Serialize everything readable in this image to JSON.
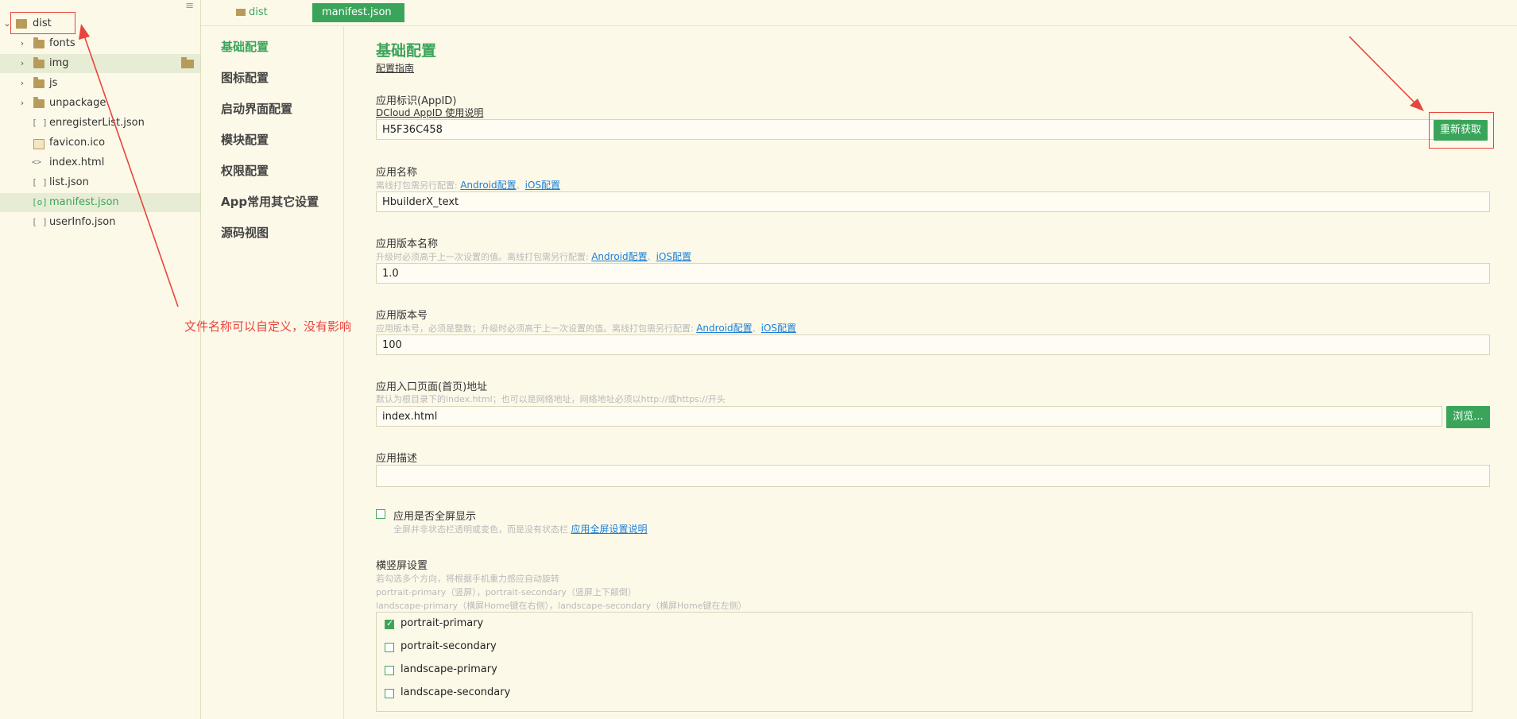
{
  "explorer": {
    "root": "dist",
    "items": [
      {
        "name": "fonts",
        "type": "folder"
      },
      {
        "name": "img",
        "type": "folder"
      },
      {
        "name": "js",
        "type": "folder"
      },
      {
        "name": "unpackage",
        "type": "folder"
      },
      {
        "name": "enregisterList.json",
        "type": "json"
      },
      {
        "name": "favicon.ico",
        "type": "image"
      },
      {
        "name": "index.html",
        "type": "html"
      },
      {
        "name": "list.json",
        "type": "json"
      },
      {
        "name": "manifest.json",
        "type": "json-active"
      },
      {
        "name": "userInfo.json",
        "type": "json"
      }
    ],
    "json_glyph": "[ ]",
    "manifest_glyph": "[o]",
    "html_glyph": "<>"
  },
  "annotation": "文件名称可以自定义，没有影响",
  "tabs": [
    {
      "label": "dist"
    },
    {
      "label": "manifest.json"
    }
  ],
  "nav": [
    "基础配置",
    "图标配置",
    "启动界面配置",
    "模块配置",
    "权限配置",
    "App常用其它设置",
    "源码视图"
  ],
  "form": {
    "title": "基础配置",
    "guide_link": "配置指南",
    "appid": {
      "label": "应用标识(AppID)",
      "help_link": "DCloud AppID 使用说明",
      "value": "H5F36C458",
      "button": "重新获取"
    },
    "name": {
      "label": "应用名称",
      "hint": "离线打包需另行配置:",
      "android": "Android配置",
      "ios": "iOS配置",
      "value": "HbuilderX_text"
    },
    "version_name": {
      "label": "应用版本名称",
      "hint": "升级时必须高于上一次设置的值。离线打包需另行配置:",
      "android": "Android配置",
      "ios": "iOS配置",
      "value": "1.0"
    },
    "version_code": {
      "label": "应用版本号",
      "hint": "应用版本号，必须是整数；升级时必须高于上一次设置的值。离线打包需另行配置:",
      "android": "Android配置",
      "ios": "iOS配置",
      "value": "100"
    },
    "entry": {
      "label": "应用入口页面(首页)地址",
      "hint": "默认为根目录下的index.html；也可以是网络地址，网络地址必须以http://或https://开头",
      "value": "index.html",
      "button": "浏览..."
    },
    "desc": {
      "label": "应用描述",
      "value": ""
    },
    "fullscreen": {
      "label": "应用是否全屏显示",
      "hint": "全屏并非状态栏透明或变色，而是没有状态栏",
      "link": "应用全屏设置说明",
      "checked": false
    },
    "orientation": {
      "label": "横竖屏设置",
      "hint1": "若勾选多个方向，将根据手机重力感应自动旋转",
      "hint2": "portrait-primary（竖屏），portrait-secondary（竖屏上下颠倒）",
      "hint3": "landscape-primary（横屏Home键在右侧），landscape-secondary（横屏Home键在左侧）",
      "options": [
        {
          "label": "portrait-primary",
          "checked": true
        },
        {
          "label": "portrait-secondary",
          "checked": false
        },
        {
          "label": "landscape-primary",
          "checked": false
        },
        {
          "label": "landscape-secondary",
          "checked": false
        }
      ]
    }
  },
  "colors": {
    "accent": "#3aa55a",
    "annotation": "#e8453c",
    "link": "#1a7fd8",
    "background": "#fdf9e9"
  }
}
